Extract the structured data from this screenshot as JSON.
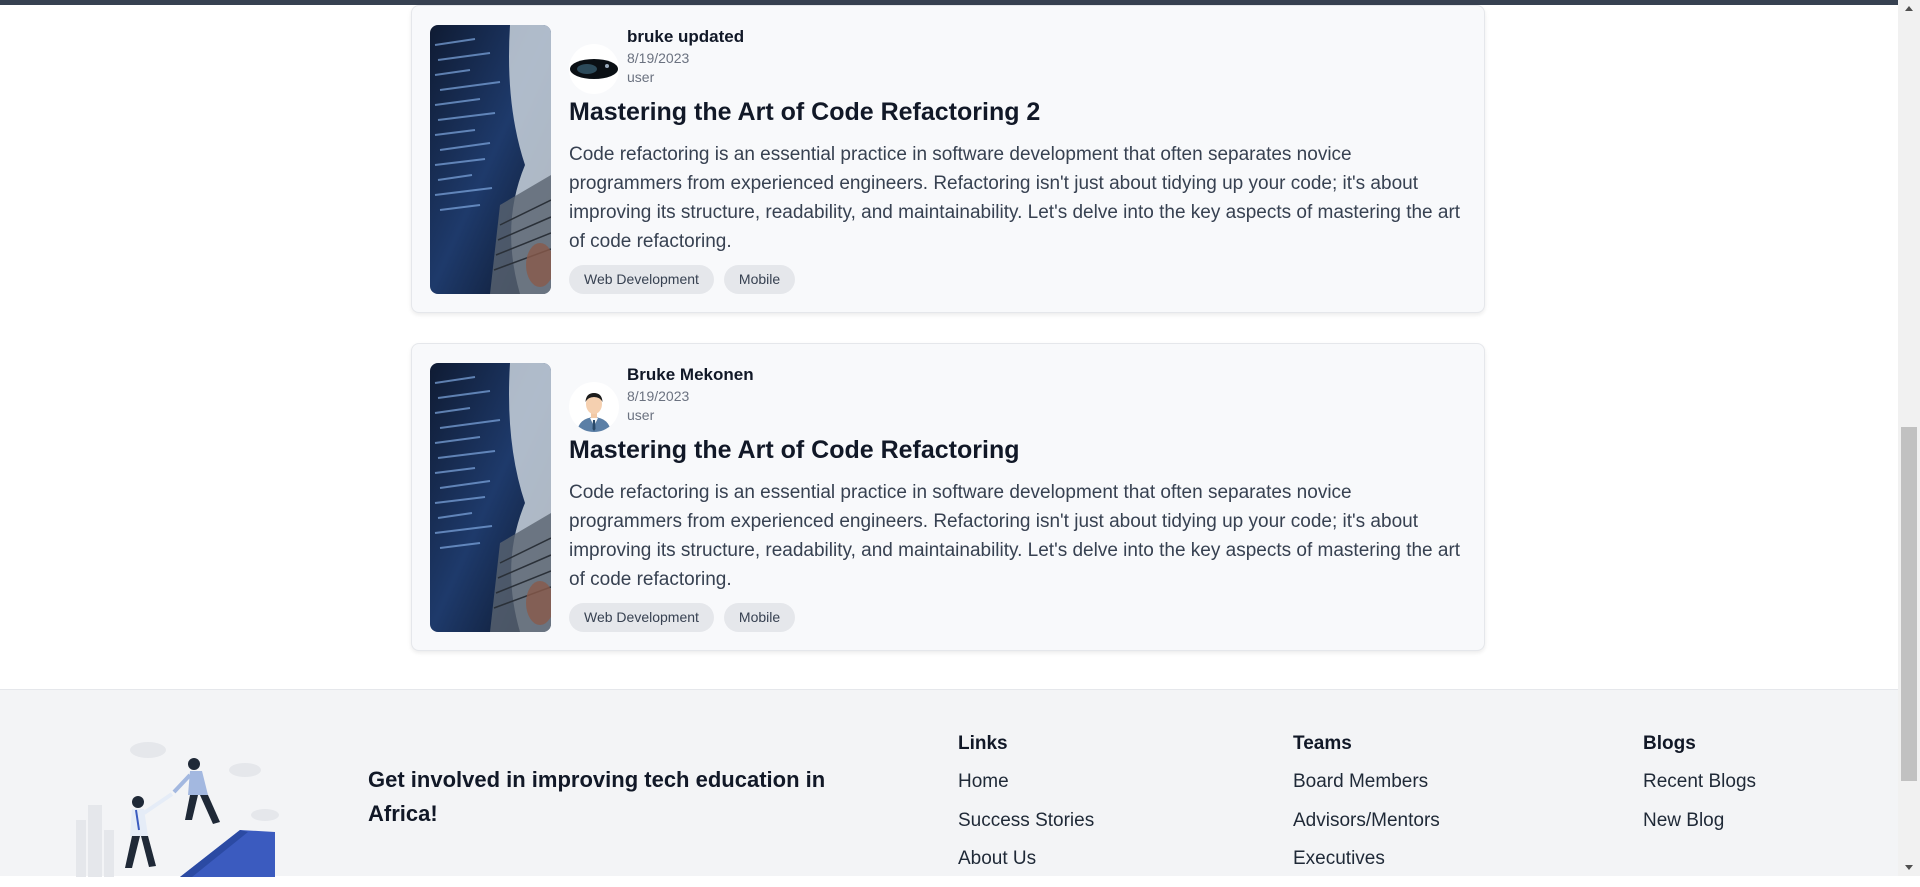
{
  "posts": [
    {
      "author": "bruke updated",
      "date": "8/19/2023",
      "role": "user",
      "title": "Mastering the Art of Code Refactoring 2",
      "excerpt": "Code refactoring is an essential practice in software development that often separates novice programmers from experienced engineers. Refactoring isn't just about tidying up your code; it's about improving its structure, readability, and maintainability. Let's delve into the key aspects of mastering the art of code refactoring.",
      "tags": [
        "Web Development",
        "Mobile"
      ]
    },
    {
      "author": "Bruke Mekonen",
      "date": "8/19/2023",
      "role": "user",
      "title": "Mastering the Art of Code Refactoring",
      "excerpt": "Code refactoring is an essential practice in software development that often separates novice programmers from experienced engineers. Refactoring isn't just about tidying up your code; it's about improving its structure, readability, and maintainability. Let's delve into the key aspects of mastering the art of code refactoring.",
      "tags": [
        "Web Development",
        "Mobile"
      ]
    }
  ],
  "footer": {
    "tagline": "Get involved in improving tech education in Africa!",
    "columns": [
      {
        "heading": "Links",
        "items": [
          "Home",
          "Success Stories",
          "About Us"
        ]
      },
      {
        "heading": "Teams",
        "items": [
          "Board Members",
          "Advisors/Mentors",
          "Executives"
        ]
      },
      {
        "heading": "Blogs",
        "items": [
          "Recent Blogs",
          "New Blog"
        ]
      }
    ]
  },
  "colors": {
    "card_bg": "#f8f9fb",
    "tag_bg": "#e5e7eb",
    "footer_bg": "#f3f4f6",
    "scroll_thumb": "#c1c1c1"
  },
  "icons": [
    "post-thumbnail-image",
    "author-avatar",
    "footer-illustration",
    "scroll-up-arrow-icon",
    "scroll-down-arrow-icon"
  ]
}
